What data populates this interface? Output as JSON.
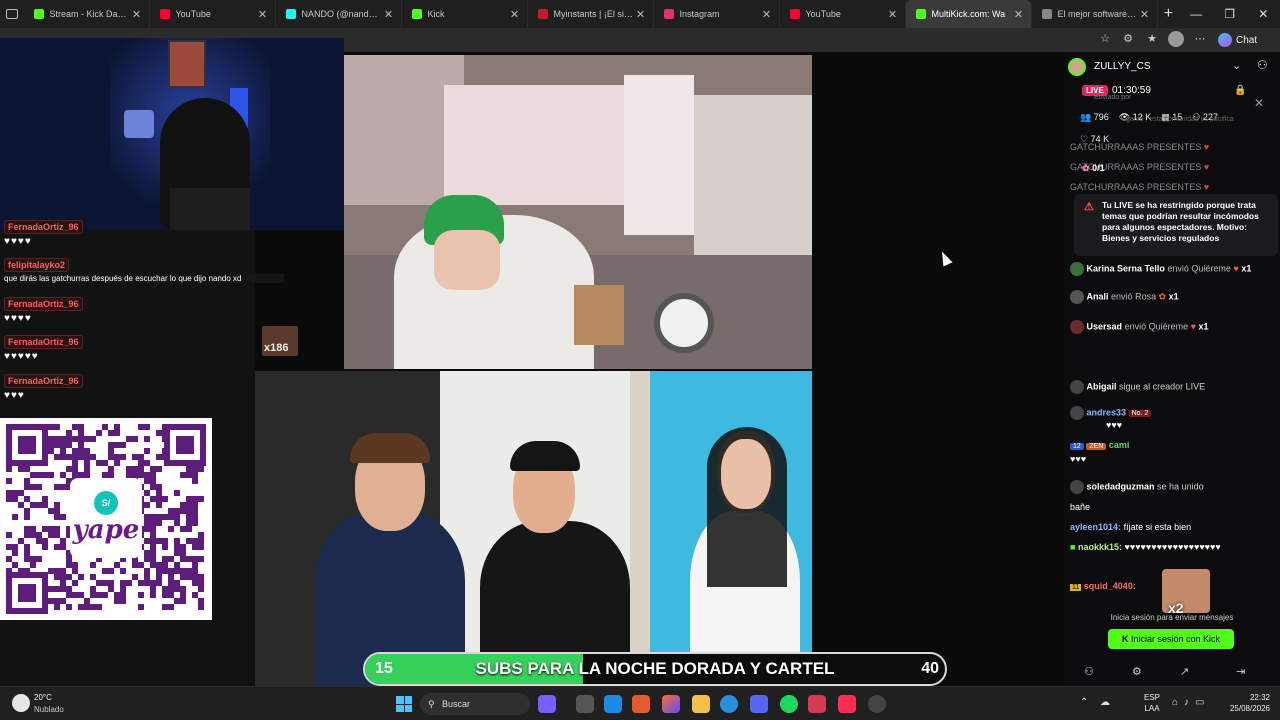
{
  "tabs": [
    {
      "title": "Stream - Kick Dashboard",
      "color": "#53fc18"
    },
    {
      "title": "YouTube",
      "color": "#ff0033"
    },
    {
      "title": "NANDO (@nandoweeck)",
      "color": "#25f4ee"
    },
    {
      "title": "Kick",
      "color": "#53fc18"
    },
    {
      "title": "Myinstants | ¡El sitio web",
      "color": "#c21b2e"
    },
    {
      "title": "Instagram",
      "color": "#e1306c"
    },
    {
      "title": "YouTube",
      "color": "#ff0033"
    },
    {
      "title": "MultiKick.com: Wa",
      "color": "#53fc18"
    },
    {
      "title": "El mejor software para",
      "color": "#888888"
    }
  ],
  "left_chat": [
    {
      "user": "FernadaOrtiz_96",
      "msg": "♥♥♥♥"
    },
    {
      "user": "felipitalayko2",
      "msg": "que dirás las gatchurras después de escuchar lo que dijo nando xd"
    },
    {
      "user": "FernadaOrtiz_96",
      "msg": "♥♥♥♥"
    },
    {
      "user": "FernadaOrtiz_96",
      "msg": "♥♥♥♥♥"
    },
    {
      "user": "FernadaOrtiz_96",
      "msg": "♥♥♥"
    }
  ],
  "qr": {
    "brand": "yape",
    "badge": "S/"
  },
  "video1": {
    "overlay": "x186"
  },
  "banner": {
    "left": "15",
    "text": "SUBS PARA LA NOCHE DORADA Y CARTEL",
    "right": "40",
    "progress": 0.375
  },
  "panel": {
    "channel": "ZULLYY_CS",
    "live_badge": "LIVE",
    "duration": "01:30:59",
    "stats": {
      "viewers": "796",
      "views": "12 K",
      "gifts": "15",
      "followers": "227",
      "likes": "74 K"
    },
    "enviado": "Enviado por",
    "faded1": "gente , esta comunidad es pacifica",
    "gatch1": "GATCHURRAAAS PRESENTES",
    "gatch2": "GATCHURRAAAS PRESENTES",
    "gatch3": "GATCHURRAAAS PRESENTES",
    "share": "0/1",
    "warning": "Tu LIVE se ha restringido porque trata temas que podrían resultar incómodos para algunos espectadores. Motivo: Bienes y servicios regulados",
    "gifts": [
      {
        "user": "Karina Serna Tello",
        "action": "envió Quiéreme",
        "count": "x1"
      },
      {
        "user": "Anali",
        "action": "envió Rosa",
        "count": "x1"
      },
      {
        "user": "Usersad",
        "action": "envió Quiéreme",
        "count": "x1"
      }
    ],
    "abigail": {
      "user": "Abigail",
      "action": "sigue al creador LIVE"
    },
    "andres": {
      "user": "andres33",
      "badge": "No. 2",
      "msg": "♥♥♥"
    },
    "zen": {
      "level": "12",
      "tag": "ZEN",
      "user": "cami",
      "msg": "♥♥♥"
    },
    "soledad": {
      "user": "soledadguzman",
      "action": "se ha unido"
    },
    "bane": "bañe",
    "ayleen": {
      "user": "ayleen1014:",
      "msg": "fíjate si esta bien"
    },
    "naokkk": {
      "user": "naokkk15:",
      "msg": "♥♥♥♥♥♥♥♥♥♥♥♥♥♥♥♥♥♥"
    },
    "squid": {
      "user": "squid_4040:",
      "msg": "x2"
    },
    "login_hint": "Inicia sesión para enviar mensajes",
    "login_button": "Iniciar sesión con Kick"
  },
  "chat_tab": "Chat",
  "taskbar": {
    "temp": "20°C",
    "weather": "Nublado",
    "search": "Buscar",
    "lang1": "ESP",
    "lang2": "LAA",
    "time": "22:32",
    "date": "25/08/2026"
  }
}
